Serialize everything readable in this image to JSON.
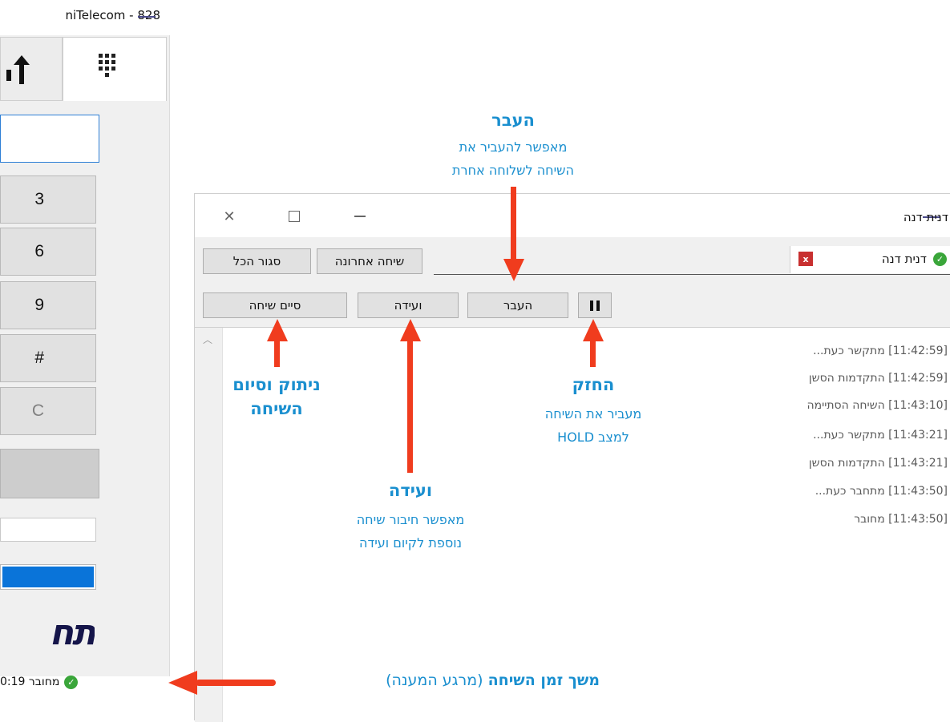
{
  "dialer": {
    "title": "niTelecom - 828",
    "keys": [
      "3",
      "6",
      "9",
      "#",
      "C"
    ],
    "status_text": "מחובר 0:19",
    "logo_text": "תח"
  },
  "call_window": {
    "title": "דנית דנה",
    "close_all_label": "סגור הכל",
    "last_call_label": "שיחה אחרונה",
    "caller_chip": {
      "name": "דנית דנה",
      "close_icon": "x"
    },
    "end_call_label": "סיים שיחה",
    "conference_label": "ועידה",
    "transfer_label": "העבר",
    "hold_icon": "pause-icon",
    "log": [
      "[11:42:59]  מתקשר כעת...",
      "[11:42:59]  התקדמות הסשן",
      "[11:43:10]  השיחה הסתיימה",
      "[11:43:21]  מתקשר כעת...",
      "[11:43:21]  התקדמות הסשן",
      "[11:43:50]  מתחבר כעת...",
      "[11:43:50]  מחובר"
    ]
  },
  "annotations": {
    "transfer": {
      "title": "העבר",
      "line1": "מאפשר להעביר את",
      "line2": "השיחה לשלוחה אחרת"
    },
    "hold": {
      "title": "החזק",
      "line1": "מעביר את השיחה",
      "line2": "למצב HOLD"
    },
    "conference": {
      "title": "ועידה",
      "line1": "מאפשר חיבור שיחה",
      "line2": "נוספת לקיום ועידה"
    },
    "hangup": {
      "line1": "ניתוק וסיום",
      "line2": "השיחה"
    },
    "duration": {
      "bold": "משך זמן השיחה",
      "normal": "(מרגע המענה)"
    }
  },
  "colors": {
    "annotation": "#1a8fcf",
    "arrow": "#f03c1e",
    "status_green": "#3aa63a"
  }
}
